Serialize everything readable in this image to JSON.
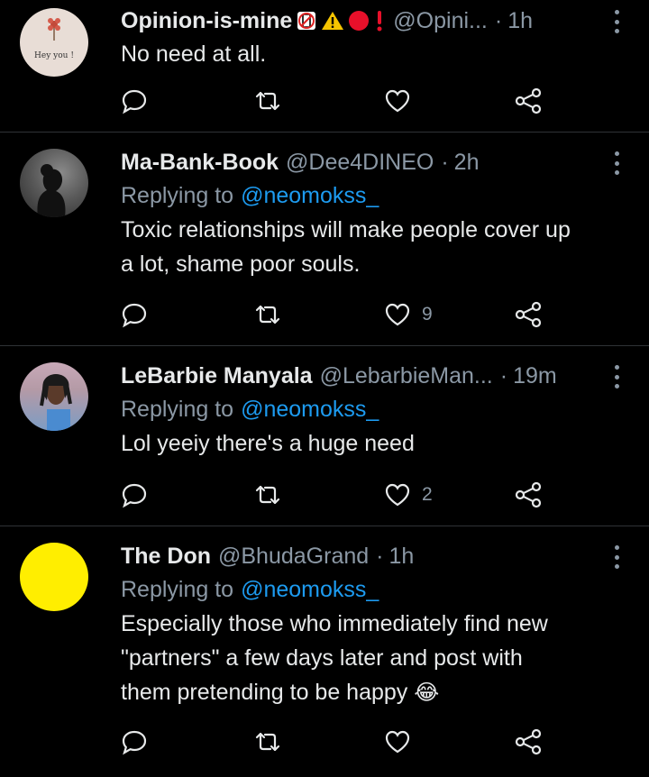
{
  "tweets": [
    {
      "name": "Opinion-is-mine",
      "handle": "@Opini...",
      "time": "1h",
      "replying_to": "",
      "text": [
        "No need at all."
      ],
      "avatar_text": "Hey you !",
      "avatar_kind": "flower-card",
      "likes": "",
      "badges": [
        "no-phone-icon",
        "warning-icon",
        "red-circle-icon",
        "exclamation-icon"
      ]
    },
    {
      "name": "Ma-Bank-Book",
      "handle": "@Dee4DINEO",
      "time": "2h",
      "replying_to_label": "Replying to",
      "replying_to": "@neomokss_",
      "text": [
        "Toxic relationships will make people cover up",
        "a lot, shame poor souls."
      ],
      "avatar_kind": "silhouette",
      "likes": "9"
    },
    {
      "name": "LeBarbie Manyala",
      "handle": "@LebarbieMan...",
      "time": "19m",
      "replying_to_label": "Replying to",
      "replying_to": "@neomokss_",
      "text": [
        "Lol yeeiy there's a huge need"
      ],
      "avatar_kind": "photo",
      "likes": "2"
    },
    {
      "name": "The Don",
      "handle": "@BhudaGrand",
      "time": "1h",
      "replying_to_label": "Replying to",
      "replying_to": "@neomokss_",
      "text": [
        "Especially those who immediately find new",
        "\"partners\" a few days later and post with",
        "them pretending to be happy"
      ],
      "emoji": "😂",
      "avatar_kind": "yellow-circle",
      "likes": ""
    }
  ],
  "colors": {
    "background": "#000000",
    "text": "#e7e9ea",
    "muted": "#8b98a5",
    "link": "#1d9bf0",
    "divider": "#2f3336"
  }
}
